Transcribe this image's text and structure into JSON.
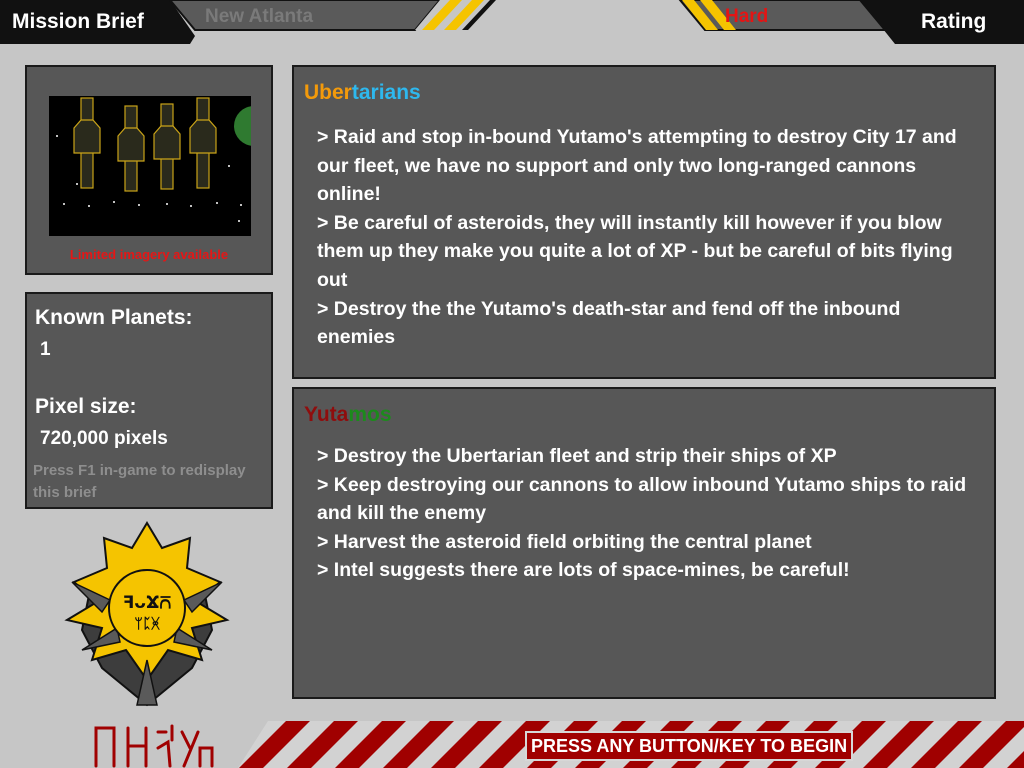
{
  "header": {
    "left_tab": "Mission Brief",
    "location": "New Atlanta",
    "difficulty": "Hard",
    "right_tab": "Rating"
  },
  "preview": {
    "caption": "Limited imagery available"
  },
  "info": {
    "planets_label": "Known Planets:",
    "planets_value": "1",
    "pixel_label": "Pixel size:",
    "pixel_value": "720,000 pixels",
    "hint": "Press F1 in-game to redisplay this brief"
  },
  "factions": [
    {
      "name_part1": "Uber",
      "name_part2": "tarians",
      "color1": "#f39a0b",
      "color2": "#2eb8ee",
      "objectives": [
        "> Raid and stop in-bound Yutamo's attempting to destroy City 17 and our fleet, we have no support and only two long-ranged cannons online!",
        "> Be careful of asteroids, they will instantly kill however if you blow them up they make you quite a lot of XP - but be careful of bits flying out",
        "> Destroy the the Yutamo's death-star and fend off the inbound enemies"
      ]
    },
    {
      "name_part1": "Yuta",
      "name_part2": "mos",
      "color1": "#8f0d0d",
      "color2": "#1c8a1c",
      "objectives": [
        "> Destroy the Ubertarian fleet and strip their ships of XP",
        "> Keep destroying our cannons to allow inbound Yutamo ships to raid and kill the enemy",
        "> Harvest the asteroid field orbiting the central planet",
        "> Intel suggests there are lots of space-mines, be careful!"
      ]
    }
  ],
  "emblem": {
    "glyphs_top": "ꟻᴗϪ⩃",
    "glyphs_bottom": "ᛘᛈᚸ"
  },
  "footer": {
    "prompt": "PRESS ANY BUTTON/KEY TO BEGIN"
  },
  "colors": {
    "panel": "#575757",
    "background": "#c6c6c6",
    "accent_yellow": "#f5c400",
    "accent_red": "#a00000"
  }
}
